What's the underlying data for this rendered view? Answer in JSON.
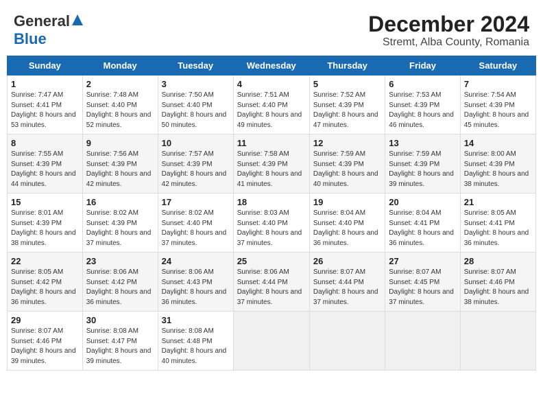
{
  "header": {
    "logo_general": "General",
    "logo_blue": "Blue",
    "title": "December 2024",
    "subtitle": "Stremt, Alba County, Romania"
  },
  "weekdays": [
    "Sunday",
    "Monday",
    "Tuesday",
    "Wednesday",
    "Thursday",
    "Friday",
    "Saturday"
  ],
  "weeks": [
    [
      {
        "day": 1,
        "sunrise": "7:47 AM",
        "sunset": "4:41 PM",
        "daylight": "8 hours and 53 minutes."
      },
      {
        "day": 2,
        "sunrise": "7:48 AM",
        "sunset": "4:40 PM",
        "daylight": "8 hours and 52 minutes."
      },
      {
        "day": 3,
        "sunrise": "7:50 AM",
        "sunset": "4:40 PM",
        "daylight": "8 hours and 50 minutes."
      },
      {
        "day": 4,
        "sunrise": "7:51 AM",
        "sunset": "4:40 PM",
        "daylight": "8 hours and 49 minutes."
      },
      {
        "day": 5,
        "sunrise": "7:52 AM",
        "sunset": "4:39 PM",
        "daylight": "8 hours and 47 minutes."
      },
      {
        "day": 6,
        "sunrise": "7:53 AM",
        "sunset": "4:39 PM",
        "daylight": "8 hours and 46 minutes."
      },
      {
        "day": 7,
        "sunrise": "7:54 AM",
        "sunset": "4:39 PM",
        "daylight": "8 hours and 45 minutes."
      }
    ],
    [
      {
        "day": 8,
        "sunrise": "7:55 AM",
        "sunset": "4:39 PM",
        "daylight": "8 hours and 44 minutes."
      },
      {
        "day": 9,
        "sunrise": "7:56 AM",
        "sunset": "4:39 PM",
        "daylight": "8 hours and 42 minutes."
      },
      {
        "day": 10,
        "sunrise": "7:57 AM",
        "sunset": "4:39 PM",
        "daylight": "8 hours and 42 minutes."
      },
      {
        "day": 11,
        "sunrise": "7:58 AM",
        "sunset": "4:39 PM",
        "daylight": "8 hours and 41 minutes."
      },
      {
        "day": 12,
        "sunrise": "7:59 AM",
        "sunset": "4:39 PM",
        "daylight": "8 hours and 40 minutes."
      },
      {
        "day": 13,
        "sunrise": "7:59 AM",
        "sunset": "4:39 PM",
        "daylight": "8 hours and 39 minutes."
      },
      {
        "day": 14,
        "sunrise": "8:00 AM",
        "sunset": "4:39 PM",
        "daylight": "8 hours and 38 minutes."
      }
    ],
    [
      {
        "day": 15,
        "sunrise": "8:01 AM",
        "sunset": "4:39 PM",
        "daylight": "8 hours and 38 minutes."
      },
      {
        "day": 16,
        "sunrise": "8:02 AM",
        "sunset": "4:39 PM",
        "daylight": "8 hours and 37 minutes."
      },
      {
        "day": 17,
        "sunrise": "8:02 AM",
        "sunset": "4:40 PM",
        "daylight": "8 hours and 37 minutes."
      },
      {
        "day": 18,
        "sunrise": "8:03 AM",
        "sunset": "4:40 PM",
        "daylight": "8 hours and 37 minutes."
      },
      {
        "day": 19,
        "sunrise": "8:04 AM",
        "sunset": "4:40 PM",
        "daylight": "8 hours and 36 minutes."
      },
      {
        "day": 20,
        "sunrise": "8:04 AM",
        "sunset": "4:41 PM",
        "daylight": "8 hours and 36 minutes."
      },
      {
        "day": 21,
        "sunrise": "8:05 AM",
        "sunset": "4:41 PM",
        "daylight": "8 hours and 36 minutes."
      }
    ],
    [
      {
        "day": 22,
        "sunrise": "8:05 AM",
        "sunset": "4:42 PM",
        "daylight": "8 hours and 36 minutes."
      },
      {
        "day": 23,
        "sunrise": "8:06 AM",
        "sunset": "4:42 PM",
        "daylight": "8 hours and 36 minutes."
      },
      {
        "day": 24,
        "sunrise": "8:06 AM",
        "sunset": "4:43 PM",
        "daylight": "8 hours and 36 minutes."
      },
      {
        "day": 25,
        "sunrise": "8:06 AM",
        "sunset": "4:44 PM",
        "daylight": "8 hours and 37 minutes."
      },
      {
        "day": 26,
        "sunrise": "8:07 AM",
        "sunset": "4:44 PM",
        "daylight": "8 hours and 37 minutes."
      },
      {
        "day": 27,
        "sunrise": "8:07 AM",
        "sunset": "4:45 PM",
        "daylight": "8 hours and 37 minutes."
      },
      {
        "day": 28,
        "sunrise": "8:07 AM",
        "sunset": "4:46 PM",
        "daylight": "8 hours and 38 minutes."
      }
    ],
    [
      {
        "day": 29,
        "sunrise": "8:07 AM",
        "sunset": "4:46 PM",
        "daylight": "8 hours and 39 minutes."
      },
      {
        "day": 30,
        "sunrise": "8:08 AM",
        "sunset": "4:47 PM",
        "daylight": "8 hours and 39 minutes."
      },
      {
        "day": 31,
        "sunrise": "8:08 AM",
        "sunset": "4:48 PM",
        "daylight": "8 hours and 40 minutes."
      },
      null,
      null,
      null,
      null
    ]
  ]
}
